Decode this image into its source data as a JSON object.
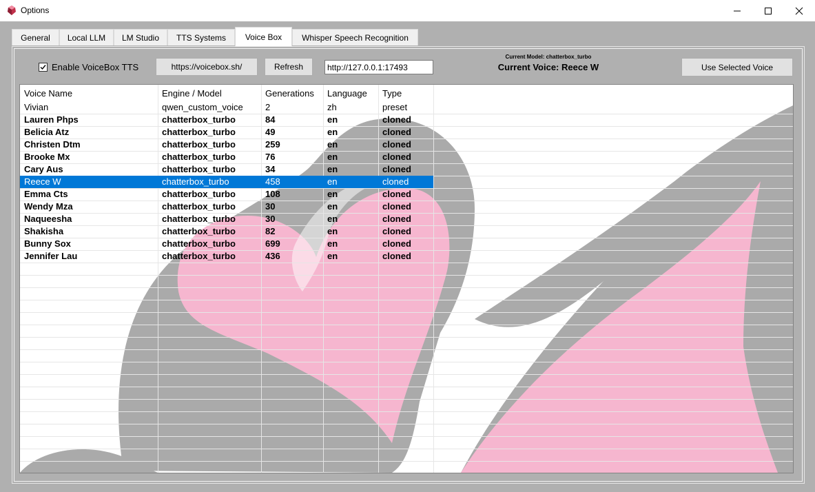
{
  "window": {
    "title": "Options",
    "icon": "app-gem-icon",
    "controls": [
      "minimize-icon",
      "maximize-icon",
      "close-icon"
    ]
  },
  "tabs": [
    {
      "label": "General"
    },
    {
      "label": "Local LLM"
    },
    {
      "label": "LM Studio"
    },
    {
      "label": "TTS Systems"
    },
    {
      "label": "Voice Box",
      "active": true
    },
    {
      "label": "Whisper Speech Recognition"
    }
  ],
  "voicebox": {
    "enable_label": "Enable VoiceBox TTS",
    "enabled": true,
    "site_button": "https://voicebox.sh/",
    "refresh_button": "Refresh",
    "url_value": "http://127.0.0.1:17493",
    "current_model": "Current Model: chatterbox_turbo",
    "current_voice": "Current Voice: Reece W",
    "use_voice_button": "Use Selected Voice"
  },
  "table": {
    "columns": [
      "Voice Name",
      "Engine / Model",
      "Generations",
      "Language",
      "Type"
    ],
    "rows": [
      {
        "name": "Vivian",
        "engine": "qwen_custom_voice",
        "generations": "2",
        "language": "zh",
        "type": "preset",
        "bold": false
      },
      {
        "name": "Lauren Phps",
        "engine": "chatterbox_turbo",
        "generations": "84",
        "language": "en",
        "type": "cloned",
        "bold": true
      },
      {
        "name": "Belicia Atz",
        "engine": "chatterbox_turbo",
        "generations": "49",
        "language": "en",
        "type": "cloned",
        "bold": true
      },
      {
        "name": "Christen Dtm",
        "engine": "chatterbox_turbo",
        "generations": "259",
        "language": "en",
        "type": "cloned",
        "bold": true
      },
      {
        "name": "Brooke Mx",
        "engine": "chatterbox_turbo",
        "generations": "76",
        "language": "en",
        "type": "cloned",
        "bold": true
      },
      {
        "name": "Cary Aus",
        "engine": "chatterbox_turbo",
        "generations": "34",
        "language": "en",
        "type": "cloned",
        "bold": true
      },
      {
        "name": "Reece W",
        "engine": "chatterbox_turbo",
        "generations": "458",
        "language": "en",
        "type": "cloned",
        "bold": false,
        "selected": true
      },
      {
        "name": "Emma Cts",
        "engine": "chatterbox_turbo",
        "generations": "108",
        "language": "en",
        "type": "cloned",
        "bold": true
      },
      {
        "name": "Wendy Mza",
        "engine": "chatterbox_turbo",
        "generations": "30",
        "language": "en",
        "type": "cloned",
        "bold": true
      },
      {
        "name": "Naqueesha",
        "engine": "chatterbox_turbo",
        "generations": "30",
        "language": "en",
        "type": "cloned",
        "bold": true
      },
      {
        "name": "Shakisha",
        "engine": "chatterbox_turbo",
        "generations": "82",
        "language": "en",
        "type": "cloned",
        "bold": true
      },
      {
        "name": "Bunny Sox",
        "engine": "chatterbox_turbo",
        "generations": "699",
        "language": "en",
        "type": "cloned",
        "bold": true
      },
      {
        "name": "Jennifer Lau",
        "engine": "chatterbox_turbo",
        "generations": "436",
        "language": "en",
        "type": "cloned",
        "bold": true
      }
    ]
  },
  "colors": {
    "selection": "#0078d7",
    "heart_pink": "#f6b6cf",
    "heart_gray": "#aaaaaa",
    "panel_gray": "#b0b0b0"
  }
}
